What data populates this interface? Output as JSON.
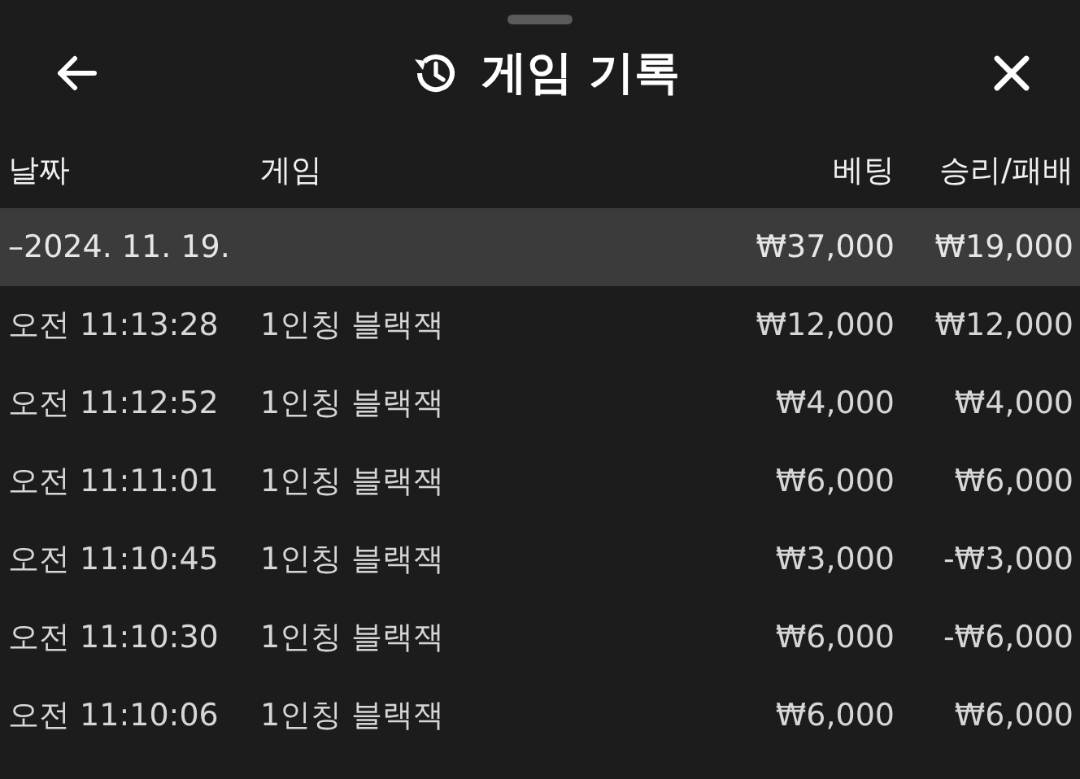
{
  "header": {
    "title": "게임 기록"
  },
  "table": {
    "columns": [
      "날짜",
      "게임",
      "베팅",
      "승리/패배"
    ],
    "group": {
      "label": "–2024. 11. 19.",
      "bet": "₩37,000",
      "result": "₩19,000"
    },
    "rows": [
      {
        "time": "오전 11:13:28",
        "game": "1인칭 블랙잭",
        "bet": "₩12,000",
        "result": "₩12,000"
      },
      {
        "time": "오전 11:12:52",
        "game": "1인칭 블랙잭",
        "bet": "₩4,000",
        "result": "₩4,000"
      },
      {
        "time": "오전 11:11:01",
        "game": "1인칭 블랙잭",
        "bet": "₩6,000",
        "result": "₩6,000"
      },
      {
        "time": "오전 11:10:45",
        "game": "1인칭 블랙잭",
        "bet": "₩3,000",
        "result": "-₩3,000"
      },
      {
        "time": "오전 11:10:30",
        "game": "1인칭 블랙잭",
        "bet": "₩6,000",
        "result": "-₩6,000"
      },
      {
        "time": "오전 11:10:06",
        "game": "1인칭 블랙잭",
        "bet": "₩6,000",
        "result": "₩6,000"
      }
    ]
  }
}
